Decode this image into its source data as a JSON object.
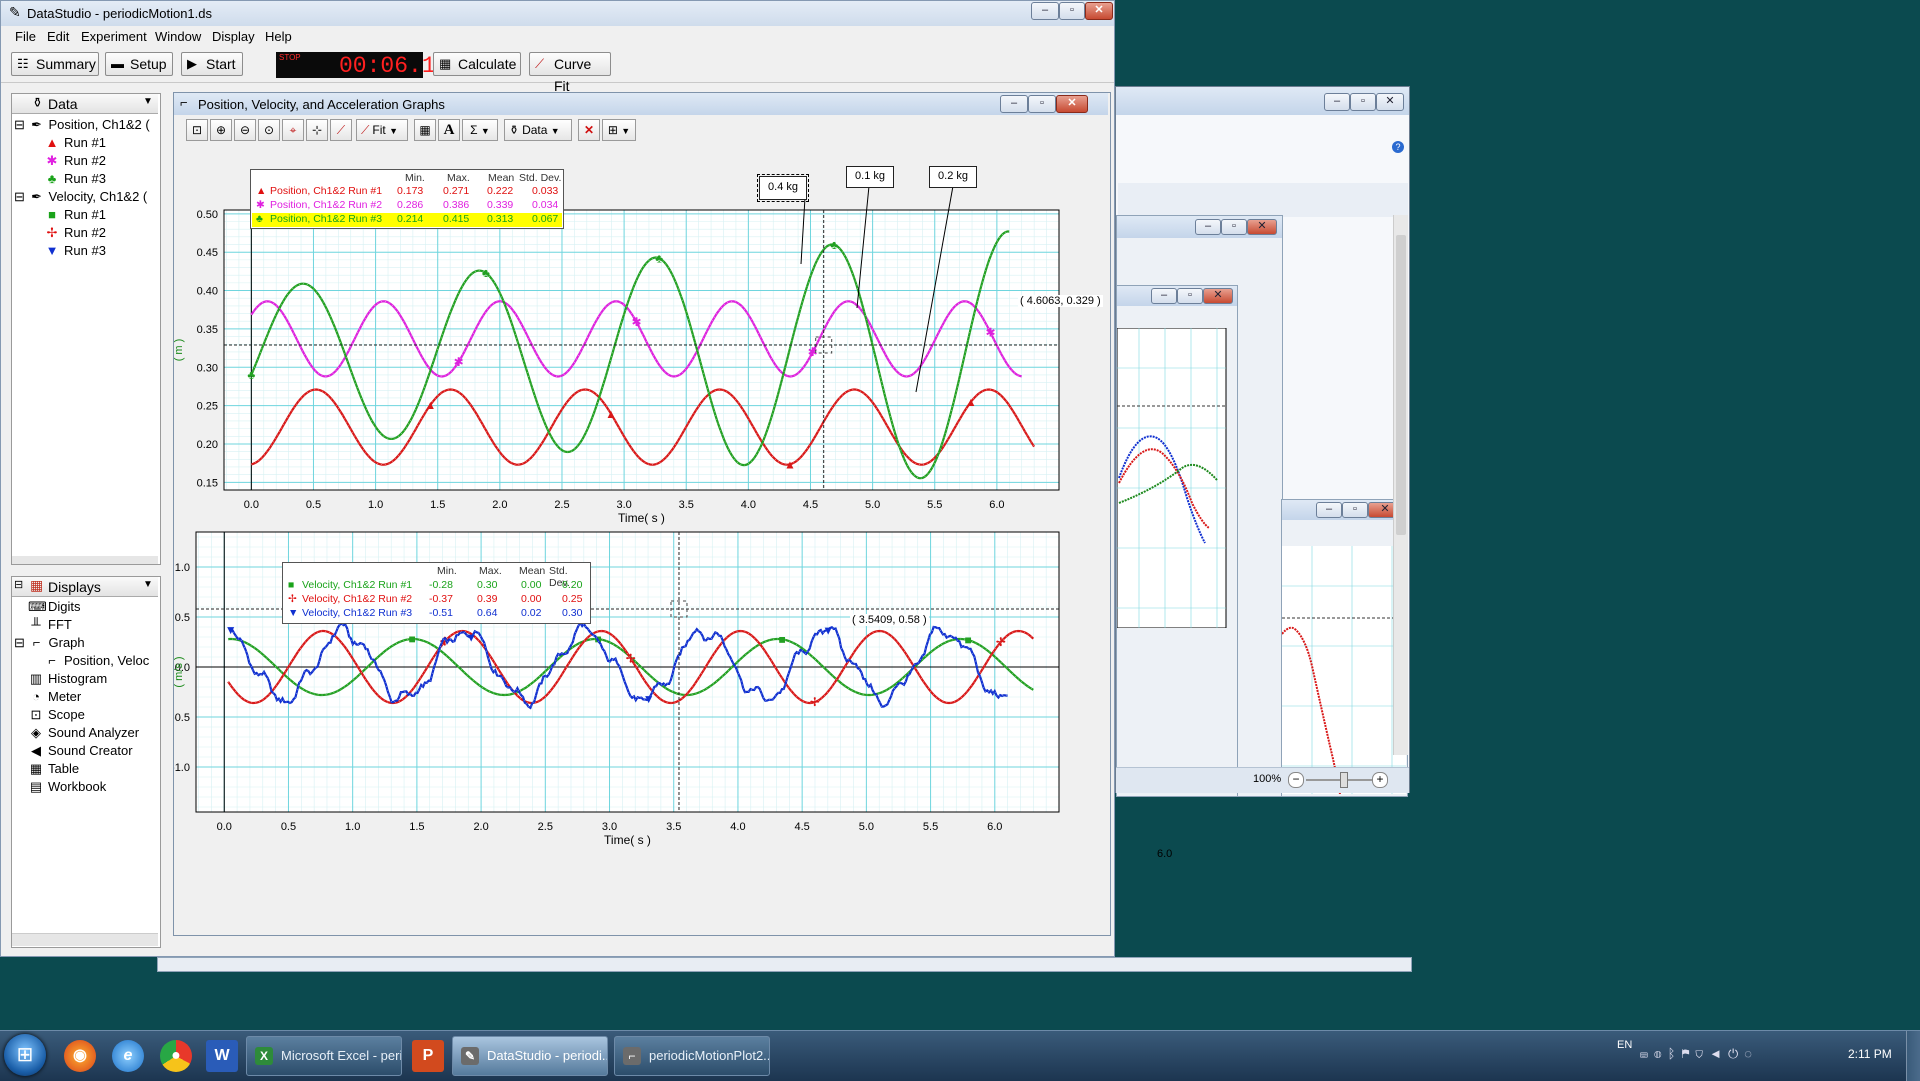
{
  "app": {
    "title": "DataStudio - periodicMotion1.ds",
    "menu": [
      "File",
      "Edit",
      "Experiment",
      "Window",
      "Display",
      "Help"
    ],
    "toolbar": {
      "summary": "Summary",
      "setup": "Setup",
      "start": "Start",
      "stop_badge": "STOP",
      "timer": "00:06.1",
      "calculate": "Calculate",
      "curve_fit": "Curve Fit"
    }
  },
  "data_panel": {
    "header": "Data",
    "items": [
      {
        "label": "Position, Ch1&2 (",
        "type": "group"
      },
      {
        "label": "Run #1",
        "color": "#e01010",
        "icon": "triangle-icon"
      },
      {
        "label": "Run #2",
        "color": "#e020e0",
        "icon": "star-icon"
      },
      {
        "label": "Run #3",
        "color": "#1aa31a",
        "icon": "clover-icon"
      },
      {
        "label": "Velocity, Ch1&2 (",
        "type": "group"
      },
      {
        "label": "Run #1",
        "color": "#1aa31a",
        "icon": "square-icon"
      },
      {
        "label": "Run #2",
        "color": "#e01010",
        "icon": "cross-icon"
      },
      {
        "label": "Run #3",
        "color": "#1030d0",
        "icon": "down-triangle-icon"
      }
    ]
  },
  "displays_panel": {
    "header": "Displays",
    "items": [
      "Digits",
      "FFT",
      "Graph",
      "Position, Veloc",
      "Histogram",
      "Meter",
      "Scope",
      "Sound Analyzer",
      "Sound Creator",
      "Table",
      "Workbook"
    ]
  },
  "graph_window": {
    "title": "Position, Velocity, and Acceleration Graphs",
    "fit_label": "Fit",
    "data_label": "Data"
  },
  "position_plot": {
    "ylabel": "( m )",
    "xlabel": "Time( s )",
    "xlim": [
      -0.22,
      6.5
    ],
    "ylim": [
      0.14,
      0.505
    ],
    "yticks": [
      "0.50",
      "0.45",
      "0.40",
      "0.35",
      "0.30",
      "0.25",
      "0.20",
      "0.15"
    ],
    "ytick_values": [
      0.5,
      0.45,
      0.4,
      0.35,
      0.3,
      0.25,
      0.2,
      0.15
    ],
    "xticks": [
      "0.0",
      "0.5",
      "1.0",
      "1.5",
      "2.0",
      "2.5",
      "3.0",
      "3.5",
      "4.0",
      "4.5",
      "5.0",
      "5.5",
      "6.0"
    ],
    "cursor_label": "( 4.6063, 0.329 )",
    "cursor": [
      4.6063,
      0.329
    ],
    "stats_header": [
      "Min.",
      "Max.",
      "Mean",
      "Std. Dev."
    ],
    "stats": [
      {
        "name": "Position, Ch1&2 Run #1",
        "min": "0.173",
        "max": "0.271",
        "mean": "0.222",
        "sd": "0.033",
        "color": "#e01010",
        "icon": "triangle-icon"
      },
      {
        "name": "Position, Ch1&2 Run #2",
        "min": "0.286",
        "max": "0.386",
        "mean": "0.339",
        "sd": "0.034",
        "color": "#e020e0",
        "icon": "star-icon"
      },
      {
        "name": "Position, Ch1&2 Run #3",
        "min": "0.214",
        "max": "0.415",
        "mean": "0.313",
        "sd": "0.067",
        "color": "#1aa31a",
        "icon": "clover-icon",
        "highlight": "#ffff00"
      }
    ],
    "annotations": [
      "0.4 kg",
      "0.1 kg",
      "0.2 kg"
    ]
  },
  "velocity_plot": {
    "ylabel": "( m/s )",
    "xlabel": "Time( s )",
    "xlim": [
      -0.22,
      6.5
    ],
    "ylim": [
      -1.45,
      1.35
    ],
    "yticks": [
      "1.0",
      "0.5",
      "0.0",
      "-0.5",
      "-1.0"
    ],
    "ytick_values": [
      1.0,
      0.5,
      0.0,
      -0.5,
      -1.0
    ],
    "xticks": [
      "0.0",
      "0.5",
      "1.0",
      "1.5",
      "2.0",
      "2.5",
      "3.0",
      "3.5",
      "4.0",
      "4.5",
      "5.0",
      "5.5",
      "6.0"
    ],
    "cursor_label": "( 3.5409, 0.58 )",
    "cursor": [
      3.5409,
      0.58
    ],
    "stats_header": [
      "Min.",
      "Max.",
      "Mean",
      "Std. Dev."
    ],
    "stats": [
      {
        "name": "Velocity, Ch1&2 Run #1",
        "min": "-0.28",
        "max": "0.30",
        "mean": "0.00",
        "sd": "0.20",
        "color": "#1aa31a",
        "icon": "square-icon"
      },
      {
        "name": "Velocity, Ch1&2 Run #2",
        "min": "-0.37",
        "max": "0.39",
        "mean": "0.00",
        "sd": "0.25",
        "color": "#e01010",
        "icon": "cross-icon"
      },
      {
        "name": "Velocity, Ch1&2 Run #3",
        "min": "-0.51",
        "max": "0.64",
        "mean": "0.02",
        "sd": "0.30",
        "color": "#1030d0",
        "icon": "down-triangle-icon"
      }
    ]
  },
  "chart_data": [
    {
      "type": "line",
      "title": "",
      "xlabel": "Time( s )",
      "ylabel": "( m )",
      "xlim": [
        0,
        6.3
      ],
      "ylim": [
        0.15,
        0.5
      ],
      "series": [
        {
          "name": "Position, Ch1&2 Run #1",
          "color": "#d81818",
          "mean": 0.222,
          "amplitude": 0.049,
          "period": 1.083,
          "peak_at": 0.52,
          "x_start": 0.0,
          "x_end": 6.3
        },
        {
          "name": "Position, Ch1&2 Run #2",
          "color": "#dd22dd",
          "mean": 0.337,
          "amplitude": 0.049,
          "period": 0.935,
          "peak_at": 0.13,
          "x_start": 0.0,
          "x_end": 6.2
        },
        {
          "name": "Position, Ch1&2 Run #3",
          "color": "#22a022",
          "mean": 0.312,
          "amplitude": 0.092,
          "period": 1.42,
          "peak_at": 0.41,
          "amp_growth": 0.012,
          "x_start": 0.0,
          "x_end": 6.1
        }
      ]
    },
    {
      "type": "line",
      "title": "",
      "xlabel": "Time( s )",
      "ylabel": "( m/s )",
      "xlim": [
        0,
        6.3
      ],
      "ylim": [
        -1.4,
        1.3
      ],
      "series": [
        {
          "name": "Velocity, Ch1&2 Run #1",
          "color": "#22a022",
          "mean": 0.0,
          "amplitude": 0.28,
          "period": 1.42,
          "peak_at": 0.05,
          "x_start": 0.03,
          "x_end": 6.3
        },
        {
          "name": "Velocity, Ch1&2 Run #2",
          "color": "#d81818",
          "mean": 0.0,
          "amplitude": 0.36,
          "period": 1.083,
          "peak_at": 0.77,
          "x_start": 0.03,
          "x_end": 6.3
        },
        {
          "name": "Velocity, Ch1&2 Run #3",
          "color": "#1030d0",
          "mean": 0.02,
          "amplitude": 0.34,
          "period": 0.935,
          "peak_at": 0.0,
          "noise": 0.09,
          "x_start": 0.05,
          "x_end": 6.1
        }
      ]
    }
  ],
  "right_window": {
    "zoom": "100%",
    "xtick": "6.0"
  },
  "taskbar": {
    "buttons": [
      {
        "label": "Microsoft Excel - peri...",
        "icon": "excel-icon",
        "color": "#2e8b3a"
      },
      {
        "label": "DataStudio - periodi...",
        "icon": "datastudio-icon",
        "color": "#6b6b6b"
      },
      {
        "label": "periodicMotionPlot2...",
        "icon": "plot-icon",
        "color": "#6b6b6b"
      }
    ],
    "lang": "EN",
    "clock": "2:11 PM"
  }
}
